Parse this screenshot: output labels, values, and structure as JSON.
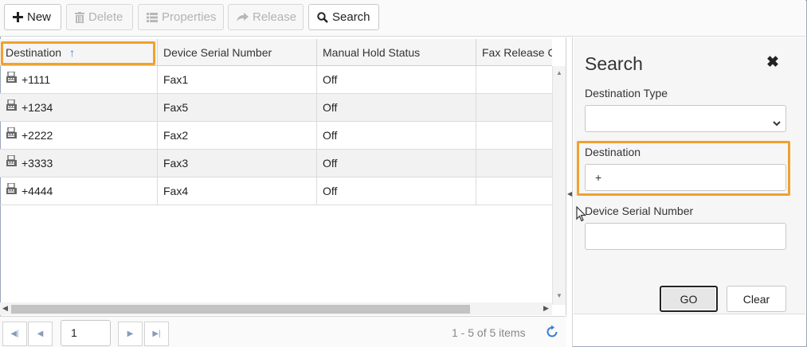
{
  "toolbar": {
    "new_label": "New",
    "delete_label": "Delete",
    "properties_label": "Properties",
    "release_label": "Release",
    "search_label": "Search"
  },
  "grid": {
    "columns": [
      "Destination",
      "Device Serial Number",
      "Manual Hold Status",
      "Fax Release C"
    ],
    "sort_column": "Destination",
    "sort_direction": "ascending",
    "rows": [
      {
        "destination": "+1111",
        "serial": "Fax1",
        "hold": "Off",
        "release": ""
      },
      {
        "destination": "+1234",
        "serial": "Fax5",
        "hold": "Off",
        "release": ""
      },
      {
        "destination": "+2222",
        "serial": "Fax2",
        "hold": "Off",
        "release": ""
      },
      {
        "destination": "+3333",
        "serial": "Fax3",
        "hold": "Off",
        "release": ""
      },
      {
        "destination": "+4444",
        "serial": "Fax4",
        "hold": "Off",
        "release": ""
      }
    ]
  },
  "pager": {
    "page": "1",
    "info": "1 - 5 of 5 items"
  },
  "search_panel": {
    "title": "Search",
    "destination_type_label": "Destination Type",
    "destination_type_value": "",
    "destination_label": "Destination",
    "destination_value": "+",
    "serial_label": "Device Serial Number",
    "serial_value": "",
    "go_label": "GO",
    "clear_label": "Clear"
  },
  "colors": {
    "highlight": "#f0a12e",
    "sort_icon": "#3b7dd8",
    "refresh_icon": "#3b7dd8"
  },
  "icons": [
    "plus-icon",
    "trash-icon",
    "list-icon",
    "share-arrow-icon",
    "magnifier-icon",
    "fax-icon",
    "sort-up-icon",
    "close-icon",
    "chevron-down-icon",
    "refresh-icon"
  ]
}
